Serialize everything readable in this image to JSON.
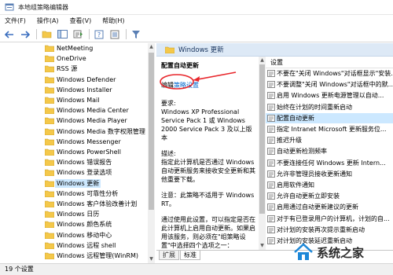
{
  "window": {
    "title": "本地组策略编辑器"
  },
  "menu": [
    "文件(F)",
    "操作(A)",
    "查看(V)",
    "帮助(H)"
  ],
  "toolbar": {
    "icons": [
      "back-arrow-icon",
      "forward-arrow-icon",
      "up-folder-icon",
      "show-tree-icon",
      "export-list-icon",
      "help-icon",
      "properties-icon",
      "filter-icon"
    ]
  },
  "tree": {
    "items": [
      "NetMeeting",
      "OneDrive",
      "RSS 源",
      "Windows Defender",
      "Windows Installer",
      "Windows Mail",
      "Windows Media Center",
      "Windows Media Player",
      "Windows Media 数字权限管理",
      "Windows Messenger",
      "Windows PowerShell",
      "Windows 错误报告",
      "Windows 登录选项",
      "Windows 更新",
      "Windows 可靠性分析",
      "Windows 客户体验改善计划",
      "Windows 日历",
      "Windows 颜色系统",
      "Windows 移动中心",
      "Windows 远程 shell",
      "Windows 远程管理(WinRM)"
    ],
    "selected_index": 13
  },
  "header": {
    "title": "Windows 更新"
  },
  "description": {
    "setting_title": "配置自动更新",
    "edit_prefix": "编辑",
    "edit_link": "策略设置",
    "requirements": "要求:\nWindows XP Professional Service Pack 1 或 Windows 2000 Service Pack 3 及以上版本",
    "desc_text": "描述:\n指定此计算机是否通过 Windows 自动更新服务来接收安全更新和其他重要下载。",
    "note_text": "注意：此策略不适用于 Windows RT。",
    "usage_text": "通过使用此设置，可以指定是否在此计算机上启用自动更新。如果启用该服务，则必须在\"组策略设置\"中选择四个选项之一："
  },
  "settings": {
    "header": "设置",
    "items": [
      "不要在\"关闭 Windows\"对话框显示\"安装...",
      "不要调整\"关闭 Windows\"对话框中的默...",
      "启用 Windows 更新电源管理以自动...",
      "始终在计划的时间重新启动",
      "配置自动更新",
      "指定 Intranet Microsoft 更新服务位...",
      "推迟升级",
      "自动更新检测频率",
      "不要连接任何 Windows 更新 Intern...",
      "允许非管理员接收更新通知",
      "启用软件通知",
      "允许自动更新立即安装",
      "启用通过自动更新建议的更新",
      "对于有已登录用户的计算机，计划的自...",
      "对计划的安装再次提示重新启动",
      "对计划的安装延迟重新启动"
    ],
    "selected_index": 4
  },
  "tabs": [
    "扩展",
    "标准"
  ],
  "status": "19 个设置",
  "watermark": "系统之家",
  "colors": {
    "selection": "#cce8ff",
    "header_band": "#dde9f6",
    "link": "#0066cc",
    "annotation": "#e8262b",
    "folder": "#f4c84a"
  }
}
